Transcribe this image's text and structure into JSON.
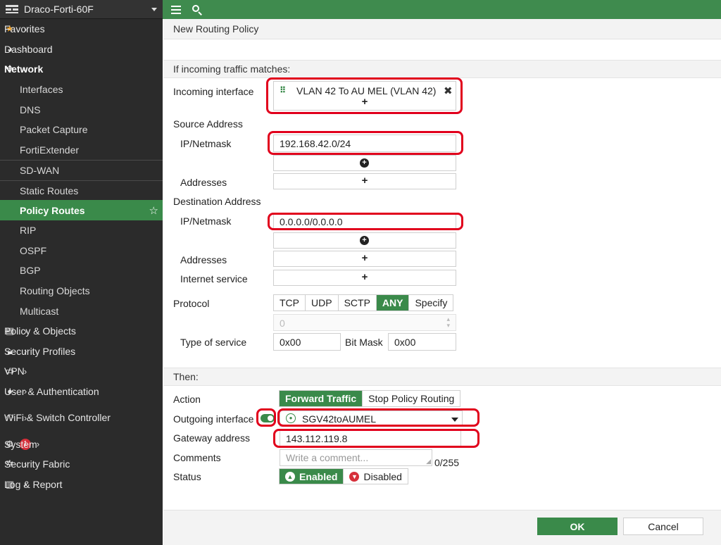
{
  "sidebar": {
    "device_name": "Draco-Forti-60F",
    "items": [
      {
        "label": "Favorites",
        "icon": "star-icon"
      },
      {
        "label": "Dashboard",
        "icon": "dashboard-icon"
      },
      {
        "label": "Network",
        "icon": "network-icon"
      },
      {
        "label": "Policy & Objects",
        "icon": "policy-icon"
      },
      {
        "label": "Security Profiles",
        "icon": "lock-icon"
      },
      {
        "label": "VPN",
        "icon": "laptop-icon"
      },
      {
        "label": "User & Authentication",
        "icon": "user-icon"
      },
      {
        "label": "WiFi & Switch Controller",
        "icon": "wifi-icon"
      },
      {
        "label": "System",
        "icon": "gear-icon",
        "badge": "1"
      },
      {
        "label": "Security Fabric",
        "icon": "fabric-icon"
      },
      {
        "label": "Log & Report",
        "icon": "chart-icon"
      }
    ],
    "network_sub": [
      "Interfaces",
      "DNS",
      "Packet Capture",
      "FortiExtender",
      "SD-WAN",
      "Static Routes",
      "Policy Routes",
      "RIP",
      "OSPF",
      "BGP",
      "Routing Objects",
      "Multicast"
    ]
  },
  "page": {
    "title": "New Routing Policy",
    "match_header": "If incoming traffic matches:",
    "then_header": "Then:"
  },
  "form": {
    "incoming_interface_label": "Incoming interface",
    "incoming_interface_value": "VLAN 42 To AU MEL (VLAN 42)",
    "source_address_label": "Source Address",
    "ip_netmask_label": "IP/Netmask",
    "source_ip": "192.168.42.0/24",
    "addresses_label": "Addresses",
    "destination_address_label": "Destination Address",
    "dest_ip": "0.0.0.0/0.0.0.0",
    "internet_service_label": "Internet service",
    "protocol_label": "Protocol",
    "protocols": [
      "TCP",
      "UDP",
      "SCTP",
      "ANY",
      "Specify"
    ],
    "protocol_selected": "ANY",
    "protocol_number": "0",
    "type_of_service_label": "Type of service",
    "type_of_service_value": "0x00",
    "bit_mask_label": "Bit Mask",
    "bit_mask_value": "0x00",
    "action_label": "Action",
    "actions": [
      "Forward Traffic",
      "Stop Policy Routing"
    ],
    "action_selected": "Forward Traffic",
    "outgoing_interface_label": "Outgoing interface",
    "outgoing_interface_value": "SGV42toAUMEL",
    "gateway_label": "Gateway address",
    "gateway_value": "143.112.119.8",
    "comments_label": "Comments",
    "comments_placeholder": "Write a comment...",
    "comments_counter": "0/255",
    "status_label": "Status",
    "status_enabled": "Enabled",
    "status_disabled": "Disabled"
  },
  "footer": {
    "ok_label": "OK",
    "cancel_label": "Cancel"
  },
  "colors": {
    "accent": "#3a8a4a",
    "topbar": "#3f8b4e",
    "sidebar_bg": "#2b2b2b",
    "highlight": "#e1001c"
  },
  "plus_symbol": "+"
}
